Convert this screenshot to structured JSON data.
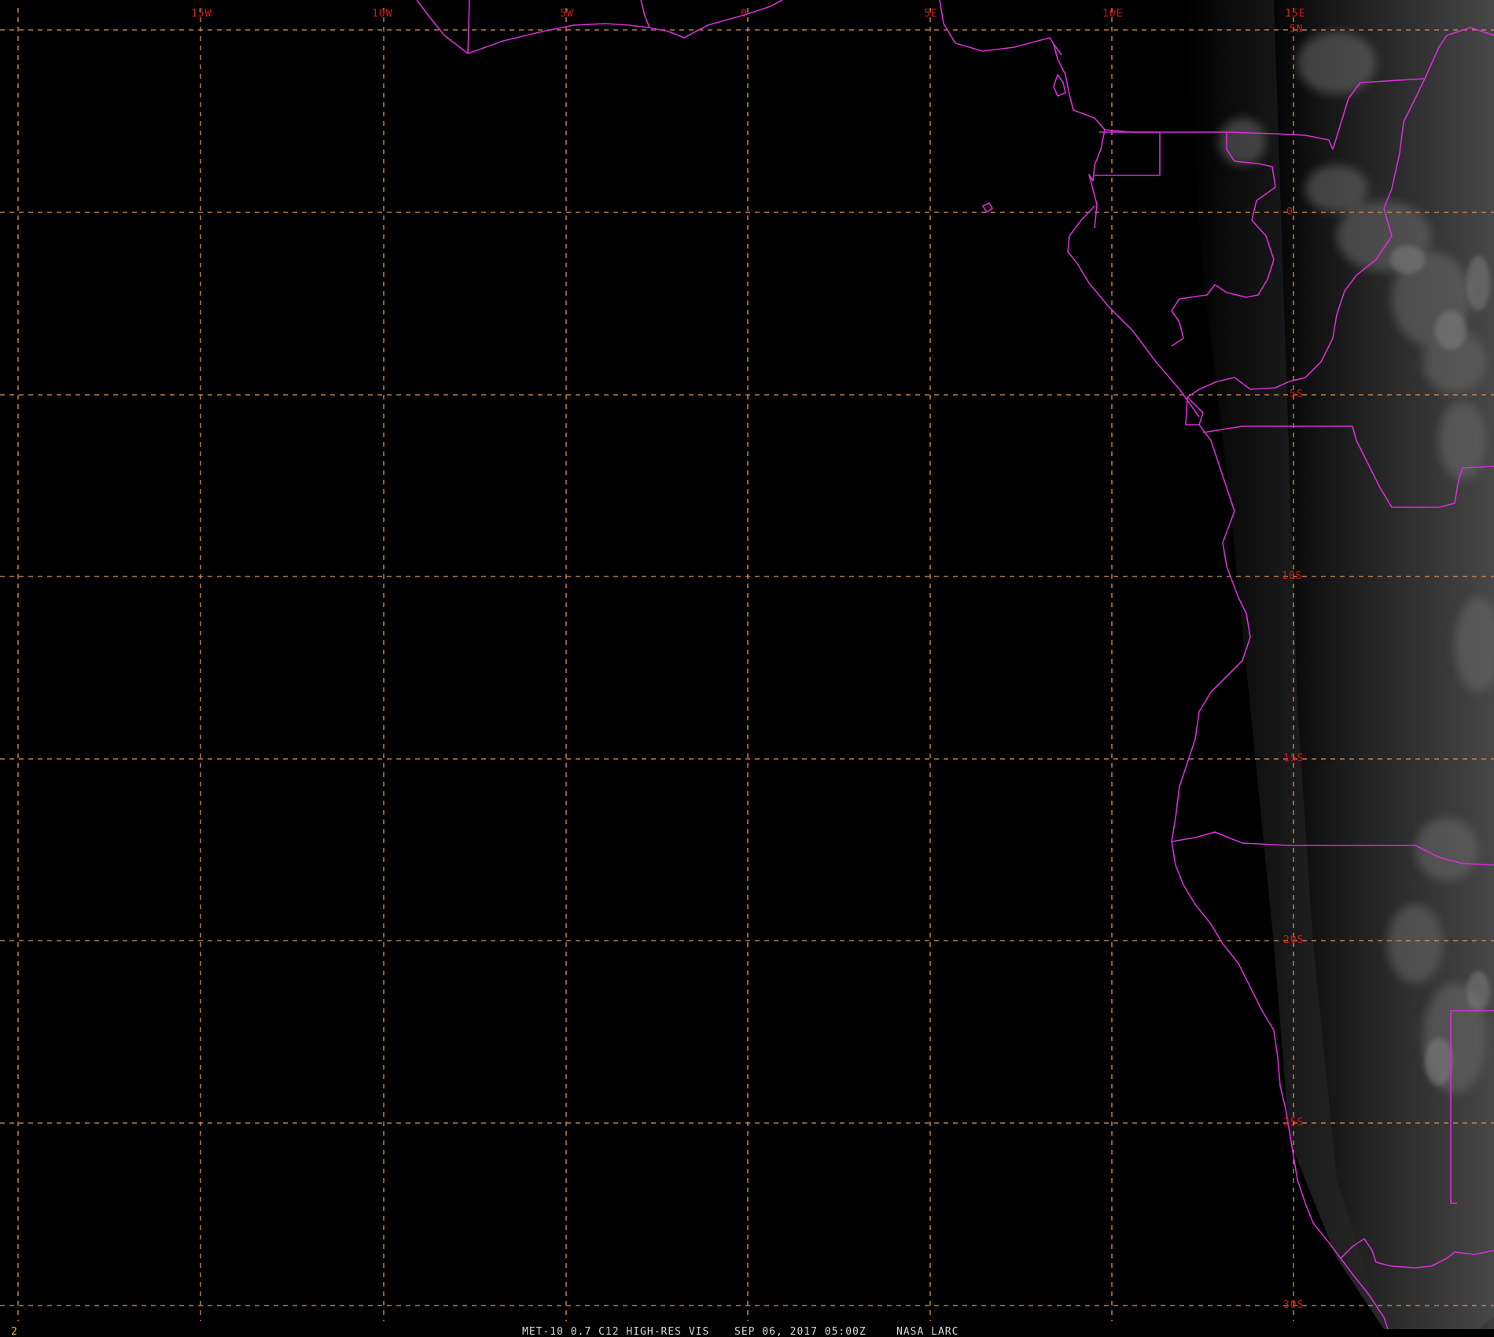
{
  "caption": {
    "product": "MET-10 0.7 C12 HIGH-RES VIS",
    "datetime": "SEP 06, 2017 05:00Z",
    "source": "NASA LARC"
  },
  "frame_number": "2",
  "grid": {
    "longitude_labels": [
      "15W",
      "10W",
      "5W",
      "0",
      "5E",
      "10E",
      "15E"
    ],
    "latitude_labels": [
      "5N",
      "0",
      "5S",
      "10S",
      "15S",
      "20S",
      "25S",
      "30S"
    ]
  },
  "colors": {
    "background": "#000000",
    "graticule": "#d9955a",
    "grid_labels": "#d01818",
    "boundaries": "#d62fd6",
    "frame_number": "#f2c200",
    "caption": "#d8d8d8",
    "cloud_land": "#5a5a5a"
  },
  "layers": {
    "imagery": "visible satellite imagery, night-side terminator on western portion",
    "boundaries": "coastlines and political boundaries"
  }
}
